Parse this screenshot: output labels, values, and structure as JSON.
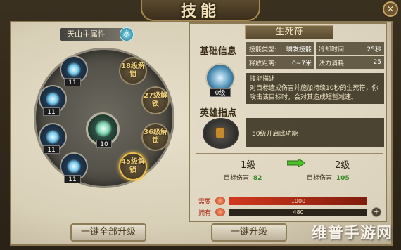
{
  "window": {
    "title": "技能",
    "close_label": "×"
  },
  "left": {
    "attribute_label": "天山主属性",
    "attribute_badge": "水",
    "slots": [
      {
        "kind": "skill",
        "level": "11"
      },
      {
        "kind": "skill",
        "level": "11"
      },
      {
        "kind": "skill",
        "level": "11"
      },
      {
        "kind": "skill",
        "level": "11"
      },
      {
        "kind": "locked",
        "text": "18级解锁"
      },
      {
        "kind": "locked",
        "text": "27级解锁"
      },
      {
        "kind": "locked",
        "text": "36级解锁"
      },
      {
        "kind": "locked",
        "text": "45级解锁"
      }
    ],
    "center_level": "10"
  },
  "skill": {
    "name": "生死符",
    "basic_info_label": "基础信息",
    "icon_level": "0级",
    "type_label": "技能类型:",
    "type_value": "瞬发技能",
    "cooldown_label": "冷却时间:",
    "cooldown_value": "25秒",
    "range_label": "释放距离:",
    "range_value": "0~7米",
    "mana_label": "法力消耗:",
    "mana_value": "25",
    "desc_label": "技能描述:",
    "description": "对目标造成伤害并施加持续10秒的生死符，你攻击该目标时，会对其造成短暂减速。",
    "hero_label": "英雄指点",
    "hero_text": "50级开启此功能"
  },
  "upgrade": {
    "from_level": "1级",
    "to_level": "2级",
    "from_damage_label": "目标伤害:",
    "from_damage_value": "82",
    "to_damage_label": "目标伤害:",
    "to_damage_value": "105",
    "need_label": "需要",
    "need_value": "1000",
    "own_label": "拥有",
    "own_value": "480",
    "plus_label": "+"
  },
  "buttons": {
    "upgrade_all": "一键全部升级",
    "upgrade_one": "一键升级"
  },
  "watermark": "维普手游网"
}
